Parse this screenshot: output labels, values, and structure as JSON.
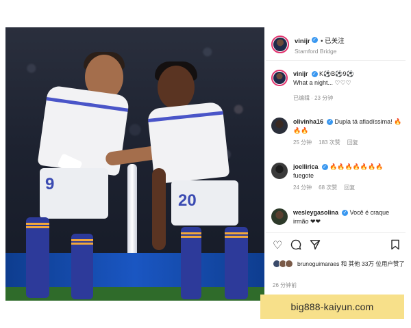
{
  "post": {
    "username": "vinijr",
    "follow_status": "已关注",
    "location": "Stamford Bridge",
    "caption_user": "vinijr",
    "caption_text": "K⚽B⚽9⚽",
    "caption_text_2": "What a night... ♡♡♡",
    "caption_meta": "已编辑 · 23 分钟"
  },
  "photo": {
    "player_left_number": "9",
    "player_right_number": "20"
  },
  "comments": [
    {
      "user": "olivinha16",
      "text": "Dupla tá afiadíssima! 🔥🔥🔥",
      "time": "25 分钟",
      "likes": "183 次赞",
      "reply": "回复"
    },
    {
      "user": "joellirica",
      "text": "🔥🔥🔥🔥🔥🔥🔥 fuegote",
      "time": "24 分钟",
      "likes": "68 次赞",
      "reply": "回复"
    },
    {
      "user": "wesleygasolina",
      "text": "Você é craque irmão ❤❤",
      "time": "",
      "likes": "",
      "reply": ""
    }
  ],
  "likes": {
    "text": "brunoguimaraes 和 其他 33万 位用户赞了"
  },
  "time_ago": "26 分钟前",
  "banner": {
    "text": "big888-kaiyun.com"
  },
  "icons": {
    "like": "heart-icon",
    "comment": "comment-icon",
    "share": "share-icon",
    "save": "bookmark-icon"
  },
  "colors": {
    "verified": "#3897f0",
    "banner_bg": "#f7e08a",
    "story_ring": "#e1306c"
  }
}
